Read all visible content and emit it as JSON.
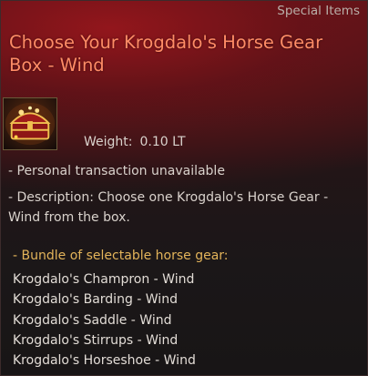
{
  "category": "Special Items",
  "title": "Choose Your Krogdalo's Horse Gear Box - Wind",
  "icon": "treasure-chest-icon",
  "weight": {
    "label": "Weight:",
    "value": "0.10 LT"
  },
  "trade_note": "- Personal transaction unavailable",
  "description": "- Description: Choose one Krogdalo's Horse Gear - Wind from the box.",
  "bundle": {
    "heading": "- Bundle of selectable horse gear:",
    "items": [
      "Krogdalo's Champron - Wind",
      "Krogdalo's Barding - Wind",
      "Krogdalo's Saddle - Wind",
      "Krogdalo's Stirrups - Wind",
      "Krogdalo's Horseshoe - Wind"
    ]
  },
  "colors": {
    "title": "#ff8c66",
    "bundle_heading": "#e3b45a",
    "text": "#d9d2cc"
  }
}
